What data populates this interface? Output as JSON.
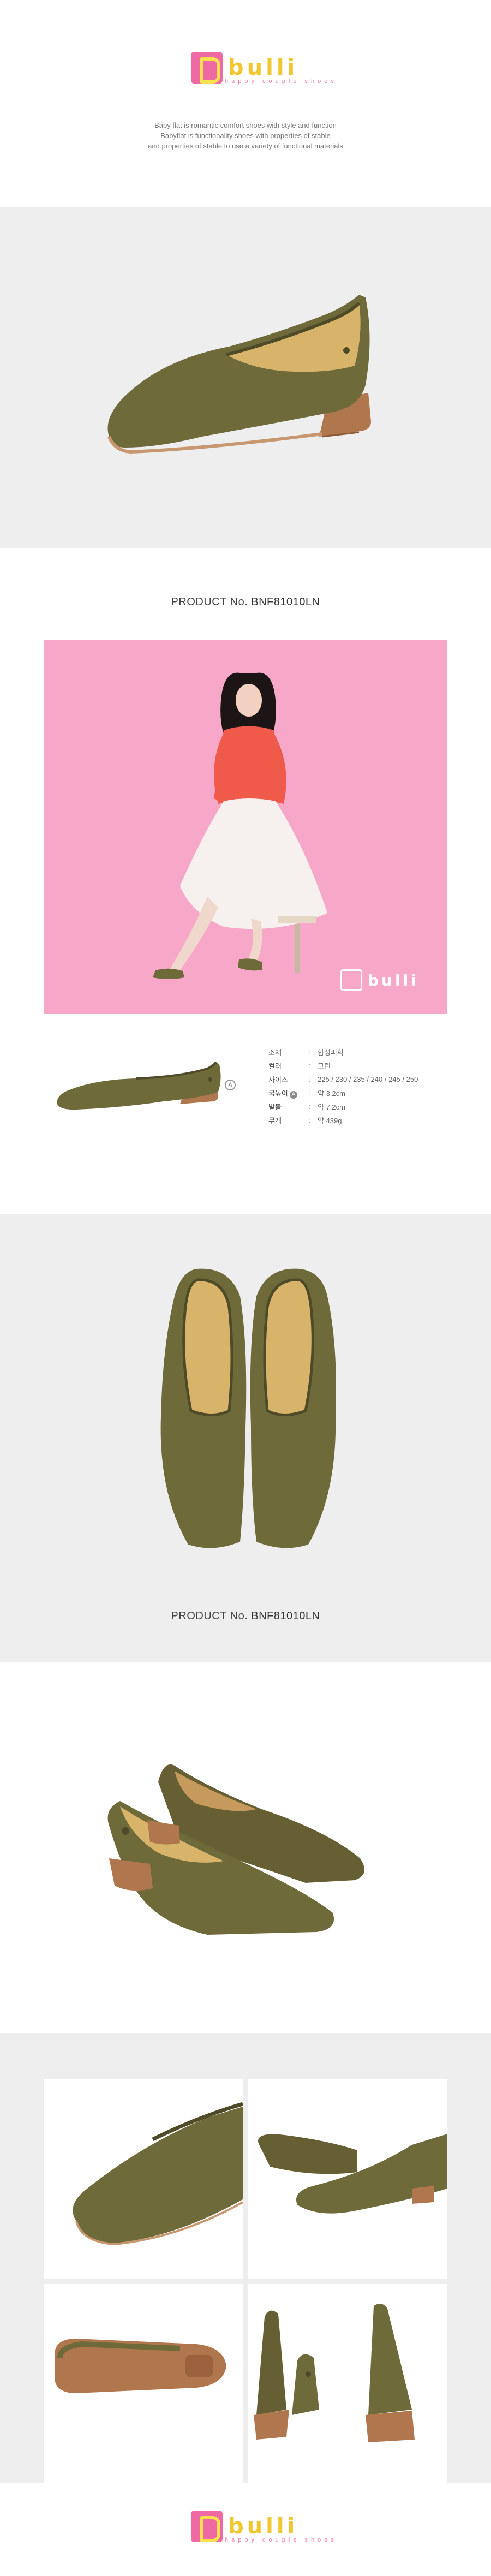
{
  "brand": {
    "logo_text": "bulli",
    "tagline": "happy couple shoes"
  },
  "intro": {
    "lines": [
      "Baby flat is romantic comfort shoes with style and function",
      "Babyflat is functionality shoes with properties of stable",
      "and properties of stable to use a variety of functional materials"
    ]
  },
  "product": {
    "label": "PRODUCT No.",
    "number": "BNF81010LN"
  },
  "specs": [
    {
      "key": "소재",
      "value": "합성피혁"
    },
    {
      "key": "컬러",
      "value": "그린"
    },
    {
      "key": "사이즈",
      "value": "225 / 230 / 235 / 240 / 245 / 250"
    },
    {
      "key": "굽높이",
      "value": "약 3.2cm",
      "marker": "A"
    },
    {
      "key": "발볼",
      "value": "약 7.2cm"
    },
    {
      "key": "무게",
      "value": "약 439g"
    }
  ],
  "colors": {
    "shoe": "#6f6a3a",
    "heel": "#b0764d",
    "pink_background": "#f7a8c9",
    "logo_pink": "#ef6aa4",
    "logo_yellow": "#f1c72f"
  },
  "icons": {
    "logo_mark": "b-square-logo",
    "heel_marker": "circled-letter"
  }
}
